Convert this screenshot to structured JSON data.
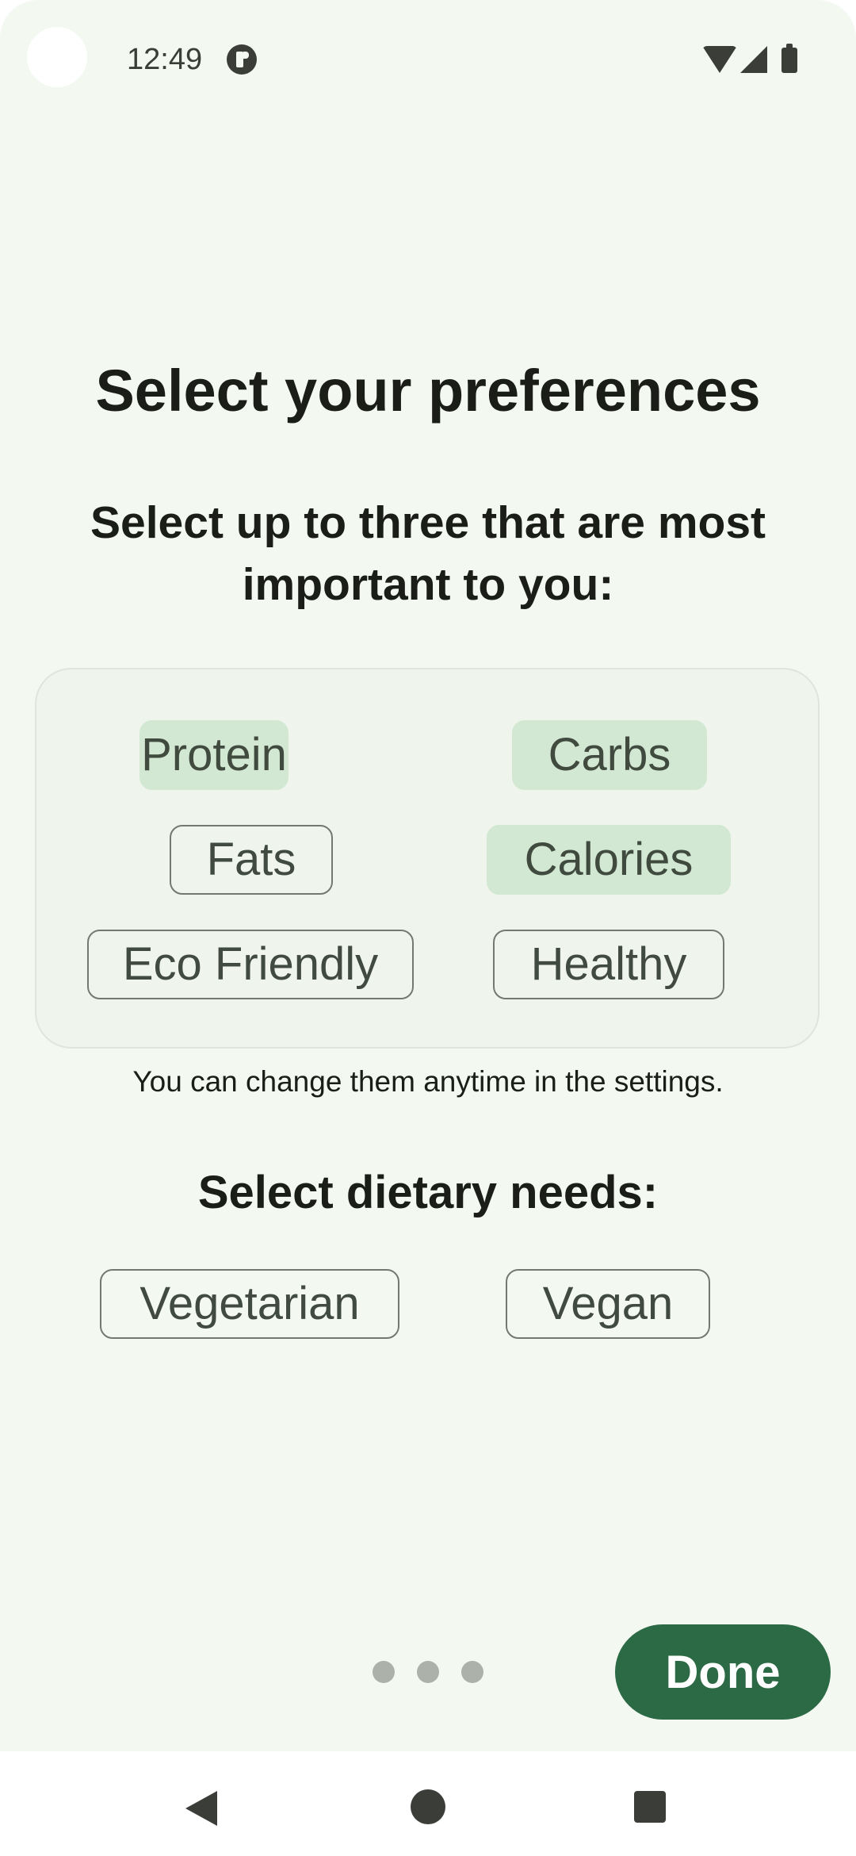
{
  "status_bar": {
    "time": "12:49",
    "icons": [
      "app-notification-icon",
      "wifi-icon",
      "signal-icon",
      "battery-icon"
    ]
  },
  "title": "Select your preferences",
  "subtitle": "Select up to three that are most important to you:",
  "preferences": [
    {
      "label": "Protein",
      "selected": true
    },
    {
      "label": "Carbs",
      "selected": true
    },
    {
      "label": "Fats",
      "selected": false
    },
    {
      "label": "Calories",
      "selected": true
    },
    {
      "label": "Eco Friendly",
      "selected": false
    },
    {
      "label": "Healthy",
      "selected": false
    }
  ],
  "hint": "You can change them anytime in the settings.",
  "dietary_title": "Select dietary needs:",
  "dietary": [
    {
      "label": "Vegetarian",
      "selected": false
    },
    {
      "label": "Vegan",
      "selected": false
    }
  ],
  "pager": {
    "count": 3,
    "active_index": 2
  },
  "done_label": "Done",
  "nav_bar": {
    "icons": [
      "back-icon",
      "home-icon",
      "recents-icon"
    ]
  },
  "colors": {
    "background": "#f3f8f1",
    "chip_selected": "#d2e8d2",
    "accent": "#2c6a45"
  }
}
